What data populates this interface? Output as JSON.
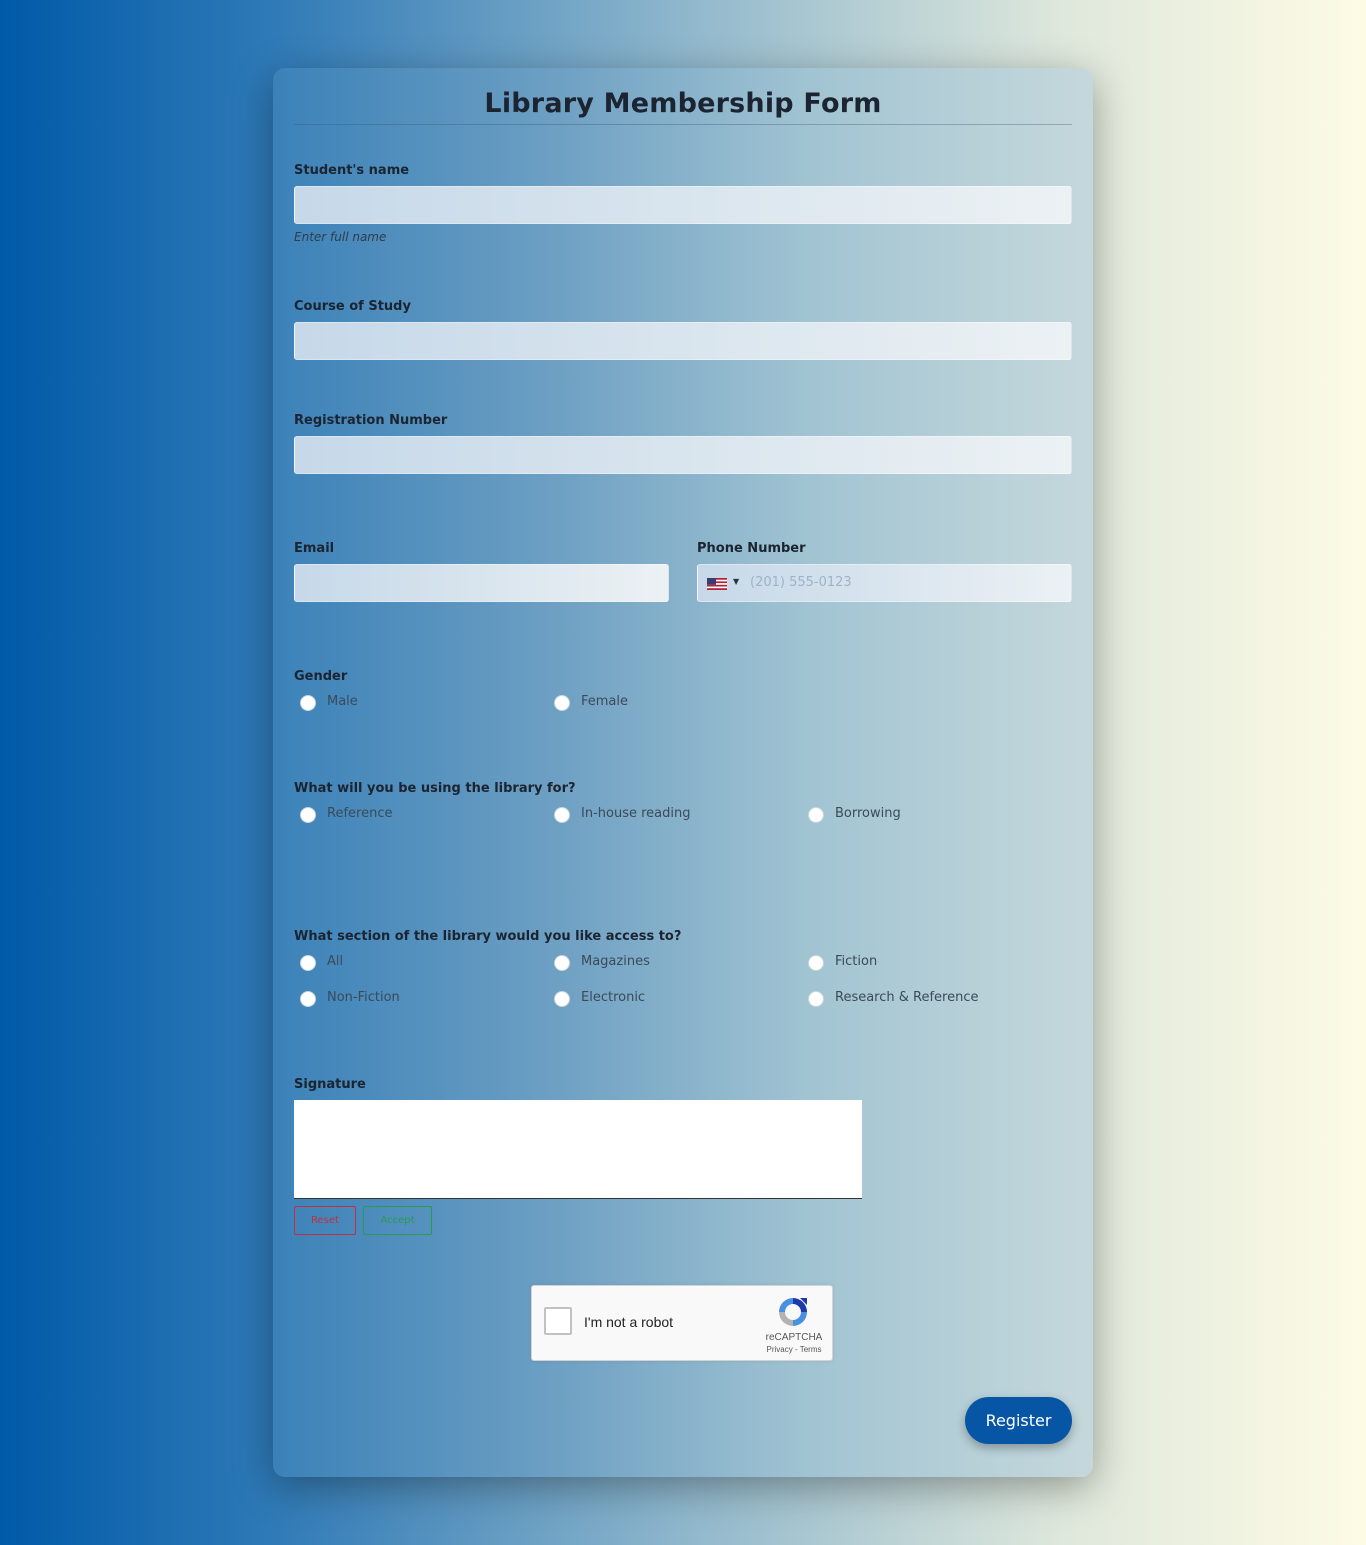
{
  "form": {
    "title": "Library Membership Form",
    "student_name": {
      "label": "Student's name",
      "value": "",
      "hint": "Enter full name"
    },
    "course": {
      "label": "Course of Study",
      "value": ""
    },
    "registration": {
      "label": "Registration Number",
      "value": ""
    },
    "email": {
      "label": "Email",
      "value": ""
    },
    "phone": {
      "label": "Phone Number",
      "country_icon": "us-flag-icon",
      "placeholder": "(201) 555-0123"
    },
    "gender": {
      "label": "Gender",
      "options": [
        "Male",
        "Female"
      ]
    },
    "usage": {
      "label": "What will you be using the library for?",
      "options": [
        "Reference",
        "In-house reading",
        "Borrowing"
      ]
    },
    "section": {
      "label": "What section of the library would you like access to?",
      "options": [
        "All",
        "Magazines",
        "Fiction",
        "Non-Fiction",
        "Electronic",
        "Research & Reference"
      ]
    },
    "signature": {
      "label": "Signature",
      "reset_label": "Reset",
      "accept_label": "Accept"
    },
    "captcha": {
      "text": "I'm not a robot",
      "brand": "reCAPTCHA",
      "privacy": "Privacy",
      "separator": " - ",
      "terms": "Terms"
    },
    "submit_label": "Register"
  },
  "colors": {
    "accent": "#0756a5",
    "reset": "#c0313f",
    "accept": "#2a9a4e",
    "background_start": "#005aa8",
    "background_end": "#fefbe5"
  }
}
